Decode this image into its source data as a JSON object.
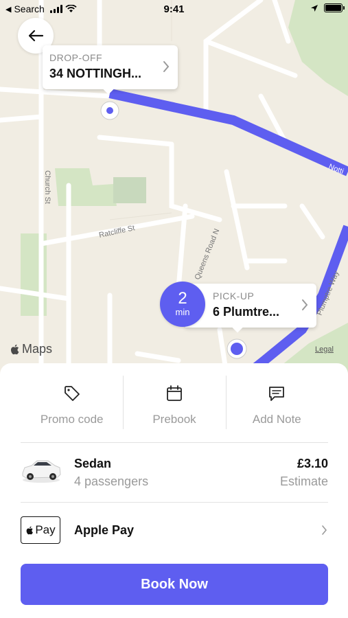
{
  "status_bar": {
    "back_app": "Search",
    "time": "9:41"
  },
  "map": {
    "streets": {
      "church_st": "Church St",
      "ratcliffe_st": "Ratcliffe St",
      "queens_road_n": "Queens Road N",
      "nottingham": "Notti",
      "plumptre_way": "Plumptre Way"
    },
    "maps_logo": "Maps",
    "legal": "Legal",
    "route_color": "#5e5ef0"
  },
  "dropoff": {
    "label": "DROP-OFF",
    "address": "34 NOTTINGH..."
  },
  "pickup": {
    "label": "PICK-UP",
    "address": "6 Plumtre...",
    "eta_value": "2",
    "eta_unit": "min"
  },
  "actions": [
    {
      "label": "Promo code",
      "icon": "tag-icon"
    },
    {
      "label": "Prebook",
      "icon": "calendar-icon"
    },
    {
      "label": "Add Note",
      "icon": "note-icon"
    }
  ],
  "ride": {
    "name": "Sedan",
    "passengers": "4 passengers",
    "price": "£3.10",
    "price_note": "Estimate"
  },
  "payment": {
    "badge": "Pay",
    "label": "Apple Pay"
  },
  "book_button": "Book Now",
  "colors": {
    "accent": "#5e5ef0",
    "muted_text": "#9a9a9a"
  }
}
